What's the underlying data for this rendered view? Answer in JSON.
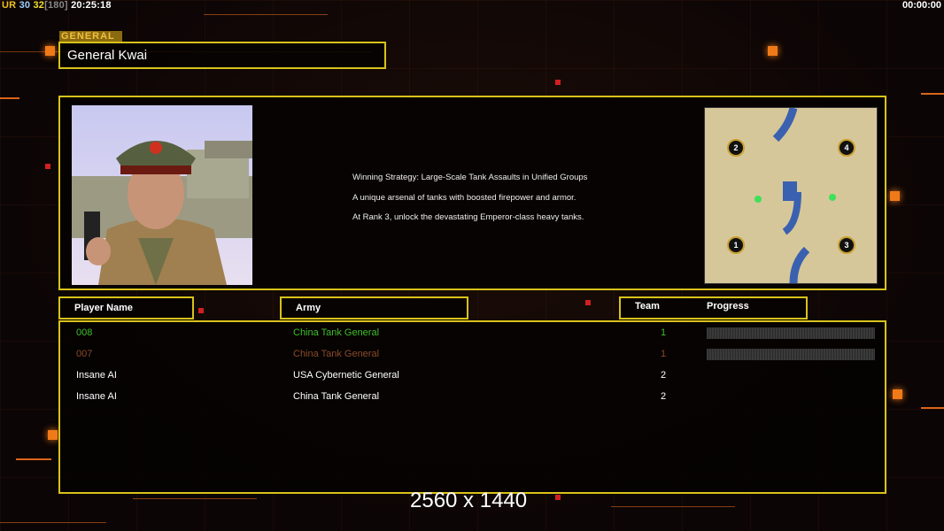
{
  "status_bar": {
    "ur": "UR",
    "a": "30",
    "b": "32",
    "c": "[180]",
    "time": "20:25:18",
    "timer": "00:00:00"
  },
  "general": {
    "tag": "GENERAL",
    "name": "General Kwai"
  },
  "strategy": [
    "Winning Strategy: Large-Scale Tank Assaults in Unified Groups",
    "A unique arsenal of tanks with boosted firepower and armor.",
    "At Rank 3, unlock the devastating Emperor-class heavy tanks."
  ],
  "map": {
    "starts": [
      "1",
      "2",
      "3",
      "4"
    ]
  },
  "headers": {
    "player": "Player Name",
    "army": "Army",
    "team": "Team",
    "progress": "Progress"
  },
  "players": [
    {
      "name": "008",
      "army": "China Tank General",
      "team": "1",
      "color": "#3fbf2a",
      "progress": 0
    },
    {
      "name": "007",
      "army": "China Tank General",
      "team": "1",
      "color": "#8a4a2a",
      "progress": 0
    },
    {
      "name": "Insane AI",
      "army": "USA Cybernetic General",
      "team": "2",
      "color": "#ffffff"
    },
    {
      "name": "Insane AI",
      "army": "China Tank General",
      "team": "2",
      "color": "#ffffff"
    }
  ],
  "resolution": "2560 x 1440"
}
